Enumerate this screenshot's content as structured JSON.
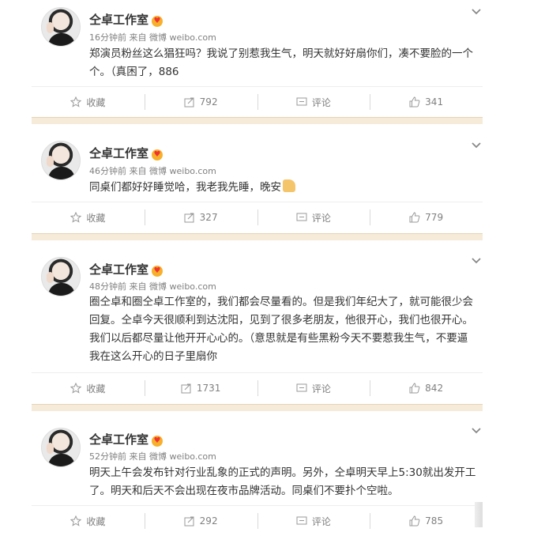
{
  "posts": [
    {
      "author": "仝卓工作室",
      "time": "16分钟前",
      "source": "来自 微博 weibo.com",
      "text": "郑演员粉丝这么猖狂吗？我说了别惹我生气，明天就好好扇你们，凑不要脸的一个个。（真困了，886",
      "collect": "收藏",
      "repost": "792",
      "comment": "评论",
      "like": "341"
    },
    {
      "author": "仝卓工作室",
      "time": "46分钟前",
      "source": "来自 微博 weibo.com",
      "text": "同桌们都好好睡觉哈，我老我先睡，晚安",
      "collect": "收藏",
      "repost": "327",
      "comment": "评论",
      "like": "779"
    },
    {
      "author": "仝卓工作室",
      "time": "48分钟前",
      "source": "来自 微博 weibo.com",
      "text": "圈仝卓和圈仝卓工作室的，我们都会尽量看的。但是我们年纪大了，就可能很少会回复。仝卓今天很顺利到达沈阳，见到了很多老朋友，他很开心，我们也很开心。我们以后都尽量让他开开心心的。（意思就是有些黑粉今天不要惹我生气，不要逼我在这么开心的日子里扇你",
      "collect": "收藏",
      "repost": "1731",
      "comment": "评论",
      "like": "842"
    },
    {
      "author": "仝卓工作室",
      "time": "52分钟前",
      "source": "来自 微博 weibo.com",
      "text": "明天上午会发布针对行业乱象的正式的声明。另外，仝卓明天早上5:30就出发开工了。明天和后天不会出现在夜市品牌活动。同桌们不要扑个空啦。",
      "collect": "收藏",
      "repost": "292",
      "comment": "评论",
      "like": "785"
    }
  ],
  "icons": {
    "collect": "star-icon",
    "repost": "share-icon",
    "comment": "comment-icon",
    "like": "thumbs-up-icon",
    "menu": "chevron-down-icon",
    "badge": "vip-badge-icon",
    "emoji": "thumbs-up-emoji"
  },
  "colors": {
    "separator": "#f6ead8",
    "meta": "#808080",
    "text": "#333333"
  }
}
